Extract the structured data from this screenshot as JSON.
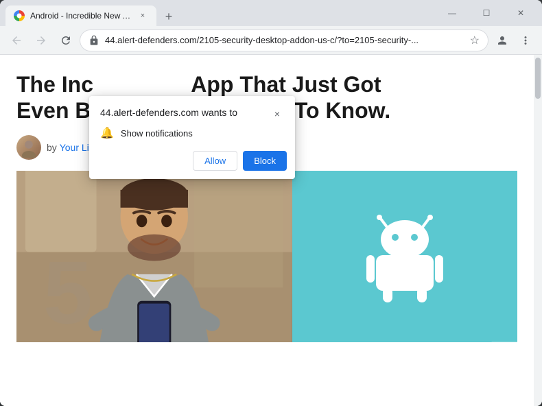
{
  "browser": {
    "tab": {
      "title": "Android - Incredible New App - I...",
      "close_label": "×"
    },
    "new_tab_label": "+",
    "window_controls": {
      "minimize": "—",
      "maximize": "☐",
      "close": "✕"
    }
  },
  "toolbar": {
    "back_label": "←",
    "forward_label": "→",
    "refresh_label": "↻",
    "url": "44.alert-defenders.com/2105-security-desktop-addon-us-c/?to=2105-security-...",
    "star_label": "☆",
    "profile_label": "👤",
    "menu_label": "⋮"
  },
  "popup": {
    "title": "44.alert-defenders.com wants to",
    "notification_label": "Show notifications",
    "close_label": "×",
    "allow_label": "Allow",
    "block_label": "Block"
  },
  "article": {
    "title_line1": "The Inc",
    "title_line2": "App That Just Got",
    "title_line3": "Even B",
    "title_line4": "You Need To Know.",
    "author_prefix": "by",
    "author_name": "Your Lifestyle"
  }
}
